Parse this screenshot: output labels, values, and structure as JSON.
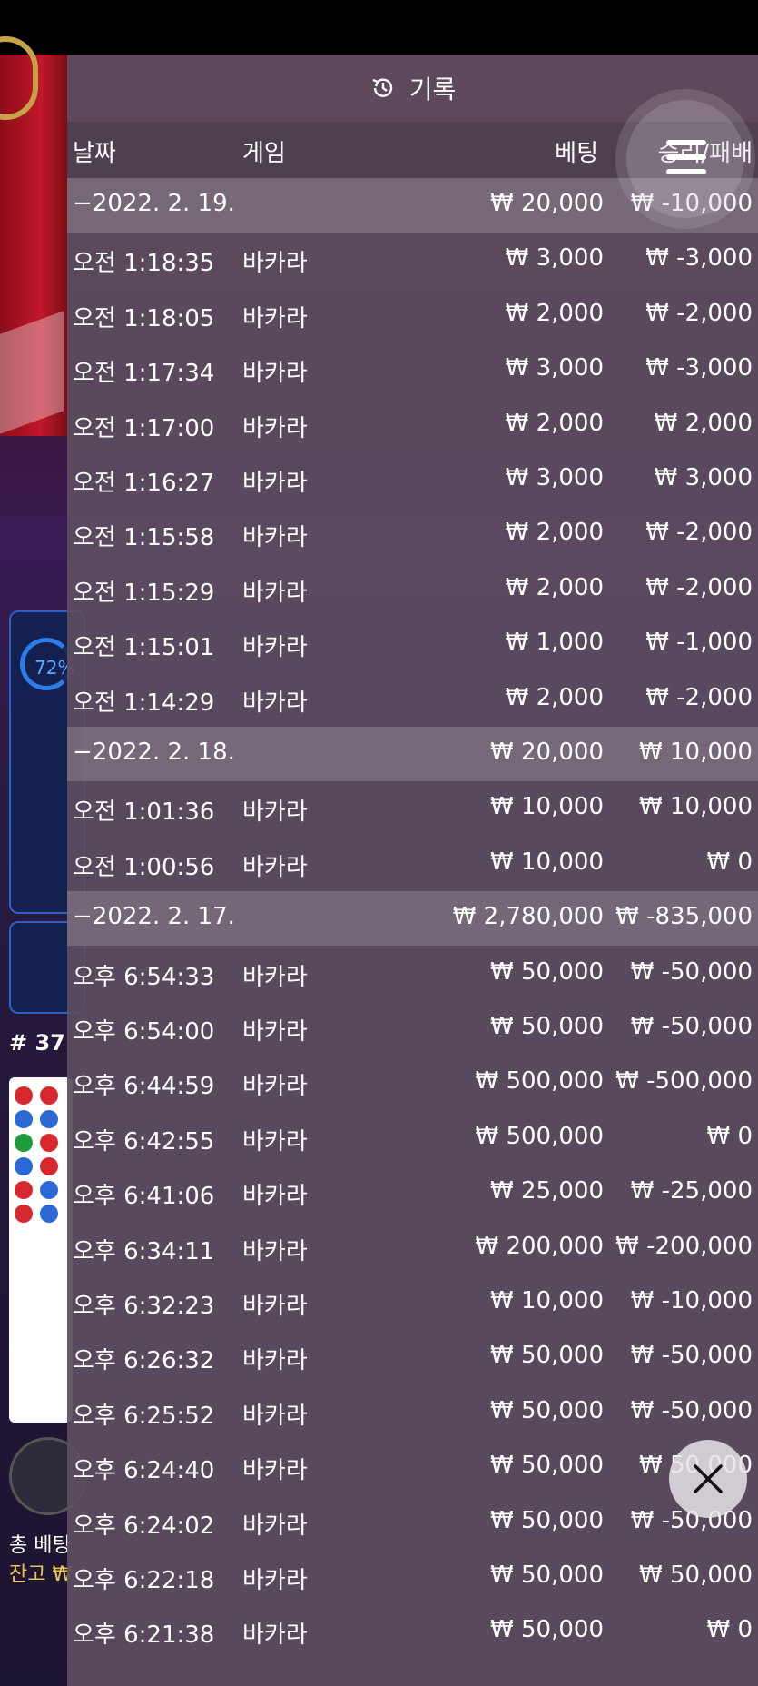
{
  "header": {
    "title": "기록",
    "icon": "history-icon"
  },
  "columns": {
    "date": "날짜",
    "game": "게임",
    "bet": "베팅",
    "winloss": "승리/패배"
  },
  "rows": [
    {
      "type": "date",
      "time": "−2022. 2. 19.",
      "game": "",
      "bet": "₩ 20,000",
      "winloss": "₩ -10,000"
    },
    {
      "type": "entry",
      "time": "오전 1:18:35",
      "game": "바카라",
      "bet": "₩ 3,000",
      "winloss": "₩ -3,000"
    },
    {
      "type": "entry",
      "time": "오전 1:18:05",
      "game": "바카라",
      "bet": "₩ 2,000",
      "winloss": "₩ -2,000"
    },
    {
      "type": "entry",
      "time": "오전 1:17:34",
      "game": "바카라",
      "bet": "₩ 3,000",
      "winloss": "₩ -3,000"
    },
    {
      "type": "entry",
      "time": "오전 1:17:00",
      "game": "바카라",
      "bet": "₩ 2,000",
      "winloss": "₩ 2,000"
    },
    {
      "type": "entry",
      "time": "오전 1:16:27",
      "game": "바카라",
      "bet": "₩ 3,000",
      "winloss": "₩ 3,000"
    },
    {
      "type": "entry",
      "time": "오전 1:15:58",
      "game": "바카라",
      "bet": "₩ 2,000",
      "winloss": "₩ -2,000"
    },
    {
      "type": "entry",
      "time": "오전 1:15:29",
      "game": "바카라",
      "bet": "₩ 2,000",
      "winloss": "₩ -2,000"
    },
    {
      "type": "entry",
      "time": "오전 1:15:01",
      "game": "바카라",
      "bet": "₩ 1,000",
      "winloss": "₩ -1,000"
    },
    {
      "type": "entry",
      "time": "오전 1:14:29",
      "game": "바카라",
      "bet": "₩ 2,000",
      "winloss": "₩ -2,000"
    },
    {
      "type": "date",
      "time": "−2022. 2. 18.",
      "game": "",
      "bet": "₩ 20,000",
      "winloss": "₩ 10,000"
    },
    {
      "type": "entry",
      "time": "오전 1:01:36",
      "game": "바카라",
      "bet": "₩ 10,000",
      "winloss": "₩ 10,000"
    },
    {
      "type": "entry",
      "time": "오전 1:00:56",
      "game": "바카라",
      "bet": "₩ 10,000",
      "winloss": "₩ 0"
    },
    {
      "type": "date",
      "time": "−2022. 2. 17.",
      "game": "",
      "bet": "₩ 2,780,000",
      "winloss": "₩ -835,000"
    },
    {
      "type": "entry",
      "time": "오후 6:54:33",
      "game": "바카라",
      "bet": "₩ 50,000",
      "winloss": "₩ -50,000"
    },
    {
      "type": "entry",
      "time": "오후 6:54:00",
      "game": "바카라",
      "bet": "₩ 50,000",
      "winloss": "₩ -50,000"
    },
    {
      "type": "entry",
      "time": "오후 6:44:59",
      "game": "바카라",
      "bet": "₩ 500,000",
      "winloss": "₩ -500,000"
    },
    {
      "type": "entry",
      "time": "오후 6:42:55",
      "game": "바카라",
      "bet": "₩ 500,000",
      "winloss": "₩ 0"
    },
    {
      "type": "entry",
      "time": "오후 6:41:06",
      "game": "바카라",
      "bet": "₩ 25,000",
      "winloss": "₩ -25,000"
    },
    {
      "type": "entry",
      "time": "오후 6:34:11",
      "game": "바카라",
      "bet": "₩ 200,000",
      "winloss": "₩ -200,000"
    },
    {
      "type": "entry",
      "time": "오후 6:32:23",
      "game": "바카라",
      "bet": "₩ 10,000",
      "winloss": "₩ -10,000"
    },
    {
      "type": "entry",
      "time": "오후 6:26:32",
      "game": "바카라",
      "bet": "₩ 50,000",
      "winloss": "₩ -50,000"
    },
    {
      "type": "entry",
      "time": "오후 6:25:52",
      "game": "바카라",
      "bet": "₩ 50,000",
      "winloss": "₩ -50,000"
    },
    {
      "type": "entry",
      "time": "오후 6:24:40",
      "game": "바카라",
      "bet": "₩ 50,000",
      "winloss": "₩ 50,000"
    },
    {
      "type": "entry",
      "time": "오후 6:24:02",
      "game": "바카라",
      "bet": "₩ 50,000",
      "winloss": "₩ -50,000"
    },
    {
      "type": "entry",
      "time": "오후 6:22:18",
      "game": "바카라",
      "bet": "₩ 50,000",
      "winloss": "₩ 50,000"
    },
    {
      "type": "entry",
      "time": "오후 6:21:38",
      "game": "바카라",
      "bet": "₩ 50,000",
      "winloss": "₩ 0"
    }
  ],
  "background": {
    "stat_percent": "72%",
    "round_label": "# 37",
    "total_bet_label": "총 베팅",
    "balance_label": "잔고 ₩"
  },
  "controls": {
    "menu_icon": "hamburger-icon",
    "close_icon": "close-icon"
  },
  "colors": {
    "panel": "#5c4e60",
    "date_row": "#8c828e",
    "accent_blue": "#2b7ee8",
    "gold": "#e9c44e"
  }
}
